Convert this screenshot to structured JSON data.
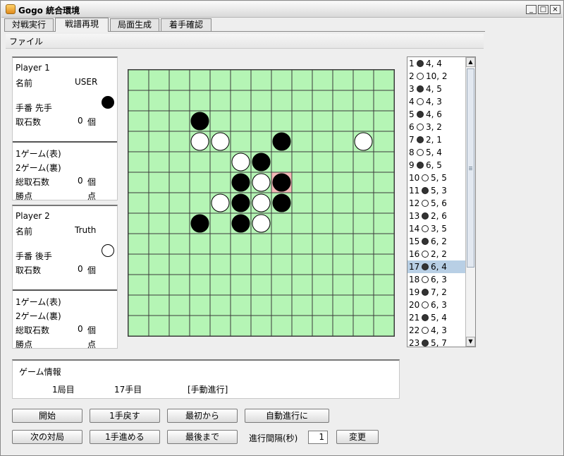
{
  "window": {
    "title": "Gogo 統合環境",
    "minimize": "_",
    "maximize": "□",
    "close": "×"
  },
  "tabs": [
    "対戦実行",
    "戦譜再現",
    "局面生成",
    "着手確認"
  ],
  "active_tab": 1,
  "menu": {
    "file": "ファイル"
  },
  "player1": {
    "header": "Player 1",
    "name_label": "名前",
    "name": "USER",
    "turn_label": "手番 先手",
    "stone": "black",
    "captured_label": "取石数",
    "captured": "0",
    "unit": "個",
    "game1": "1ゲーム(表)",
    "game2": "2ゲーム(裏)",
    "total_label": "総取石数",
    "total": "0",
    "total_unit": "個",
    "points_label": "勝点",
    "points_unit": "点"
  },
  "player2": {
    "header": "Player 2",
    "name_label": "名前",
    "name": "Truth",
    "turn_label": "手番 後手",
    "stone": "white",
    "captured_label": "取石数",
    "captured": "0",
    "unit": "個",
    "game1": "1ゲーム(表)",
    "game2": "2ゲーム(裏)",
    "total_label": "総取石数",
    "total": "0",
    "total_unit": "個",
    "points_label": "勝点",
    "points_unit": "点"
  },
  "board": {
    "size": 13,
    "stones": [
      {
        "col": 3,
        "row": 2,
        "color": "black"
      },
      {
        "col": 3,
        "row": 3,
        "color": "white"
      },
      {
        "col": 4,
        "row": 3,
        "color": "white"
      },
      {
        "col": 7,
        "row": 3,
        "color": "black"
      },
      {
        "col": 11,
        "row": 3,
        "color": "white"
      },
      {
        "col": 5,
        "row": 4,
        "color": "white"
      },
      {
        "col": 6,
        "row": 4,
        "color": "black"
      },
      {
        "col": 5,
        "row": 5,
        "color": "black"
      },
      {
        "col": 6,
        "row": 5,
        "color": "white"
      },
      {
        "col": 7,
        "row": 5,
        "color": "black",
        "highlight": true
      },
      {
        "col": 4,
        "row": 6,
        "color": "white"
      },
      {
        "col": 5,
        "row": 6,
        "color": "black"
      },
      {
        "col": 6,
        "row": 6,
        "color": "white"
      },
      {
        "col": 7,
        "row": 6,
        "color": "black"
      },
      {
        "col": 3,
        "row": 7,
        "color": "black"
      },
      {
        "col": 5,
        "row": 7,
        "color": "black"
      },
      {
        "col": 6,
        "row": 7,
        "color": "white"
      }
    ],
    "highlight_color": "#f4b8b8",
    "background": "#b5f5b5"
  },
  "moves": [
    {
      "n": "1",
      "c": "b",
      "pos": "4, 4"
    },
    {
      "n": "2",
      "c": "w",
      "pos": "10, 2"
    },
    {
      "n": "3",
      "c": "b",
      "pos": "4, 5"
    },
    {
      "n": "4",
      "c": "w",
      "pos": "4, 3"
    },
    {
      "n": "5",
      "c": "b",
      "pos": "4, 6"
    },
    {
      "n": "6",
      "c": "w",
      "pos": "3, 2"
    },
    {
      "n": "7",
      "c": "b",
      "pos": "2, 1"
    },
    {
      "n": "8",
      "c": "w",
      "pos": "5, 4"
    },
    {
      "n": "9",
      "c": "b",
      "pos": "6, 5"
    },
    {
      "n": "10",
      "c": "w",
      "pos": "5, 5"
    },
    {
      "n": "11",
      "c": "b",
      "pos": "5, 3"
    },
    {
      "n": "12",
      "c": "w",
      "pos": "5, 6"
    },
    {
      "n": "13",
      "c": "b",
      "pos": "2, 6"
    },
    {
      "n": "14",
      "c": "w",
      "pos": "3, 5"
    },
    {
      "n": "15",
      "c": "b",
      "pos": "6, 2"
    },
    {
      "n": "16",
      "c": "w",
      "pos": "2, 2"
    },
    {
      "n": "17",
      "c": "b",
      "pos": "6, 4"
    },
    {
      "n": "18",
      "c": "w",
      "pos": "6, 3"
    },
    {
      "n": "19",
      "c": "b",
      "pos": "7, 2"
    },
    {
      "n": "20",
      "c": "w",
      "pos": "6, 3"
    },
    {
      "n": "21",
      "c": "b",
      "pos": "5, 4"
    },
    {
      "n": "22",
      "c": "w",
      "pos": "4, 3"
    },
    {
      "n": "23",
      "c": "b",
      "pos": "5, 7"
    }
  ],
  "selected_move": 16,
  "game_info": {
    "header": "ゲーム情報",
    "round": "1局目",
    "move": "17手目",
    "mode": "[手動進行]"
  },
  "buttons": {
    "start": "開始",
    "back1": "1手戻す",
    "first": "最初から",
    "auto": "自動進行に",
    "next_game": "次の対局",
    "fwd1": "1手進める",
    "last": "最後まで",
    "change": "変更"
  },
  "interval": {
    "label": "進行間隔(秒)",
    "value": "1"
  }
}
